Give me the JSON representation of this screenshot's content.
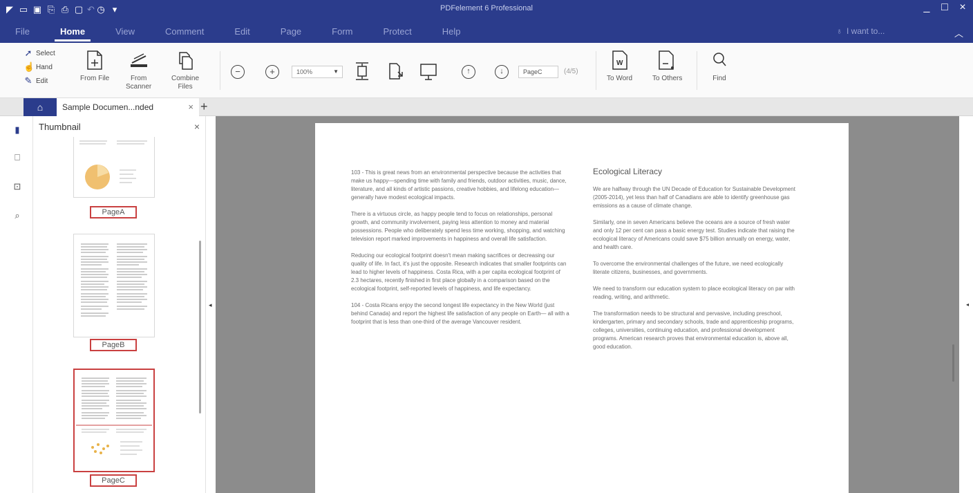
{
  "titlebar": {
    "app_title": "PDFelement 6 Professional",
    "window_controls": [
      "_",
      "□",
      "×"
    ]
  },
  "menu": {
    "items": [
      "File",
      "Home",
      "View",
      "Comment",
      "Edit",
      "Page",
      "Form",
      "Protect",
      "Help"
    ],
    "active": "Home",
    "search_label": "I want to..."
  },
  "ribbon": {
    "select": "Select",
    "hand": "Hand",
    "edit": "Edit",
    "from_file": "From File",
    "from_scanner_1": "From",
    "from_scanner_2": "Scanner",
    "combine_1": "Combine",
    "combine_2": "Files",
    "zoom": "100%",
    "page_field": "PageC",
    "page_count": "(4/5)",
    "to_word": "To Word",
    "to_others": "To Others",
    "find": "Find"
  },
  "tabs": {
    "doc_title": "Sample Documen...nded",
    "close": "×",
    "add": "+"
  },
  "thumbnail": {
    "title": "Thumbnail",
    "close": "×",
    "pages": [
      "PageA",
      "PageB",
      "PageC"
    ]
  },
  "page": {
    "left_col": [
      "103 - This is great news from an environmental perspective because the activities that make us happy—spending time with family and friends, outdoor activities, music, dance, literature, and all kinds of artistic passions, creative hobbies, and lifelong education— generally have modest ecological impacts.",
      "There is a virtuous circle, as happy people tend to focus on relationships, personal growth, and community involvement, paying less attention to money and material possessions. People who deliberately spend less time working, shopping, and watching television report marked improvements in happiness and overall life satisfaction.",
      "Reducing our ecological footprint doesn't mean making sacrifices or decreasing our quality of life. In fact, it's just the opposite. Research indicates that smaller footprints can lead to higher levels of happiness. Costa Rica, with a per capita ecological footprint of 2.3 hectares, recently finished in first place globally in a comparison based on the ecological footprint, self-reported levels of happiness, and life expectancy.",
      "104 - Costa Ricans enjoy the second longest life expectancy in the New World (just behind Canada) and report the highest life satisfaction of any people on Earth— all with a footprint that is less than one-third of the average Vancouver resident."
    ],
    "right_heading": "Ecological Literacy",
    "right_col": [
      "We are halfway through the UN Decade of Education for Sustainable Development (2005-2014), yet less than half of Canadians are able to identify greenhouse gas emissions as a cause of climate change.",
      "Similarly, one in seven Americans believe the oceans are a source of fresh water and only 12 per cent can pass a basic energy test. Studies indicate that raising the ecological literacy of Americans could save $75 billion annually on energy, water, and health care.",
      "To overcome the environmental challenges of the future, we need ecologically literate citizens, businesses, and governments.",
      "We need to transform our education system to place ecological literacy on par with reading, writing, and arithmetic.",
      "The transformation needs to be structural and pervasive, including preschool, kindergarten, primary and secondary schools, trade and apprenticeship programs, colleges, universities, continuing education, and professional development programs. American research proves that environmental education is, above all, good education."
    ]
  },
  "colors": {
    "brand": "#2b3c8c",
    "selection": "#c94040",
    "canvas": "#8c8c8c"
  },
  "icons": {
    "rail": [
      "bookmark-panel-icon",
      "bookmark-icon",
      "comment-icon",
      "search-icon"
    ]
  }
}
